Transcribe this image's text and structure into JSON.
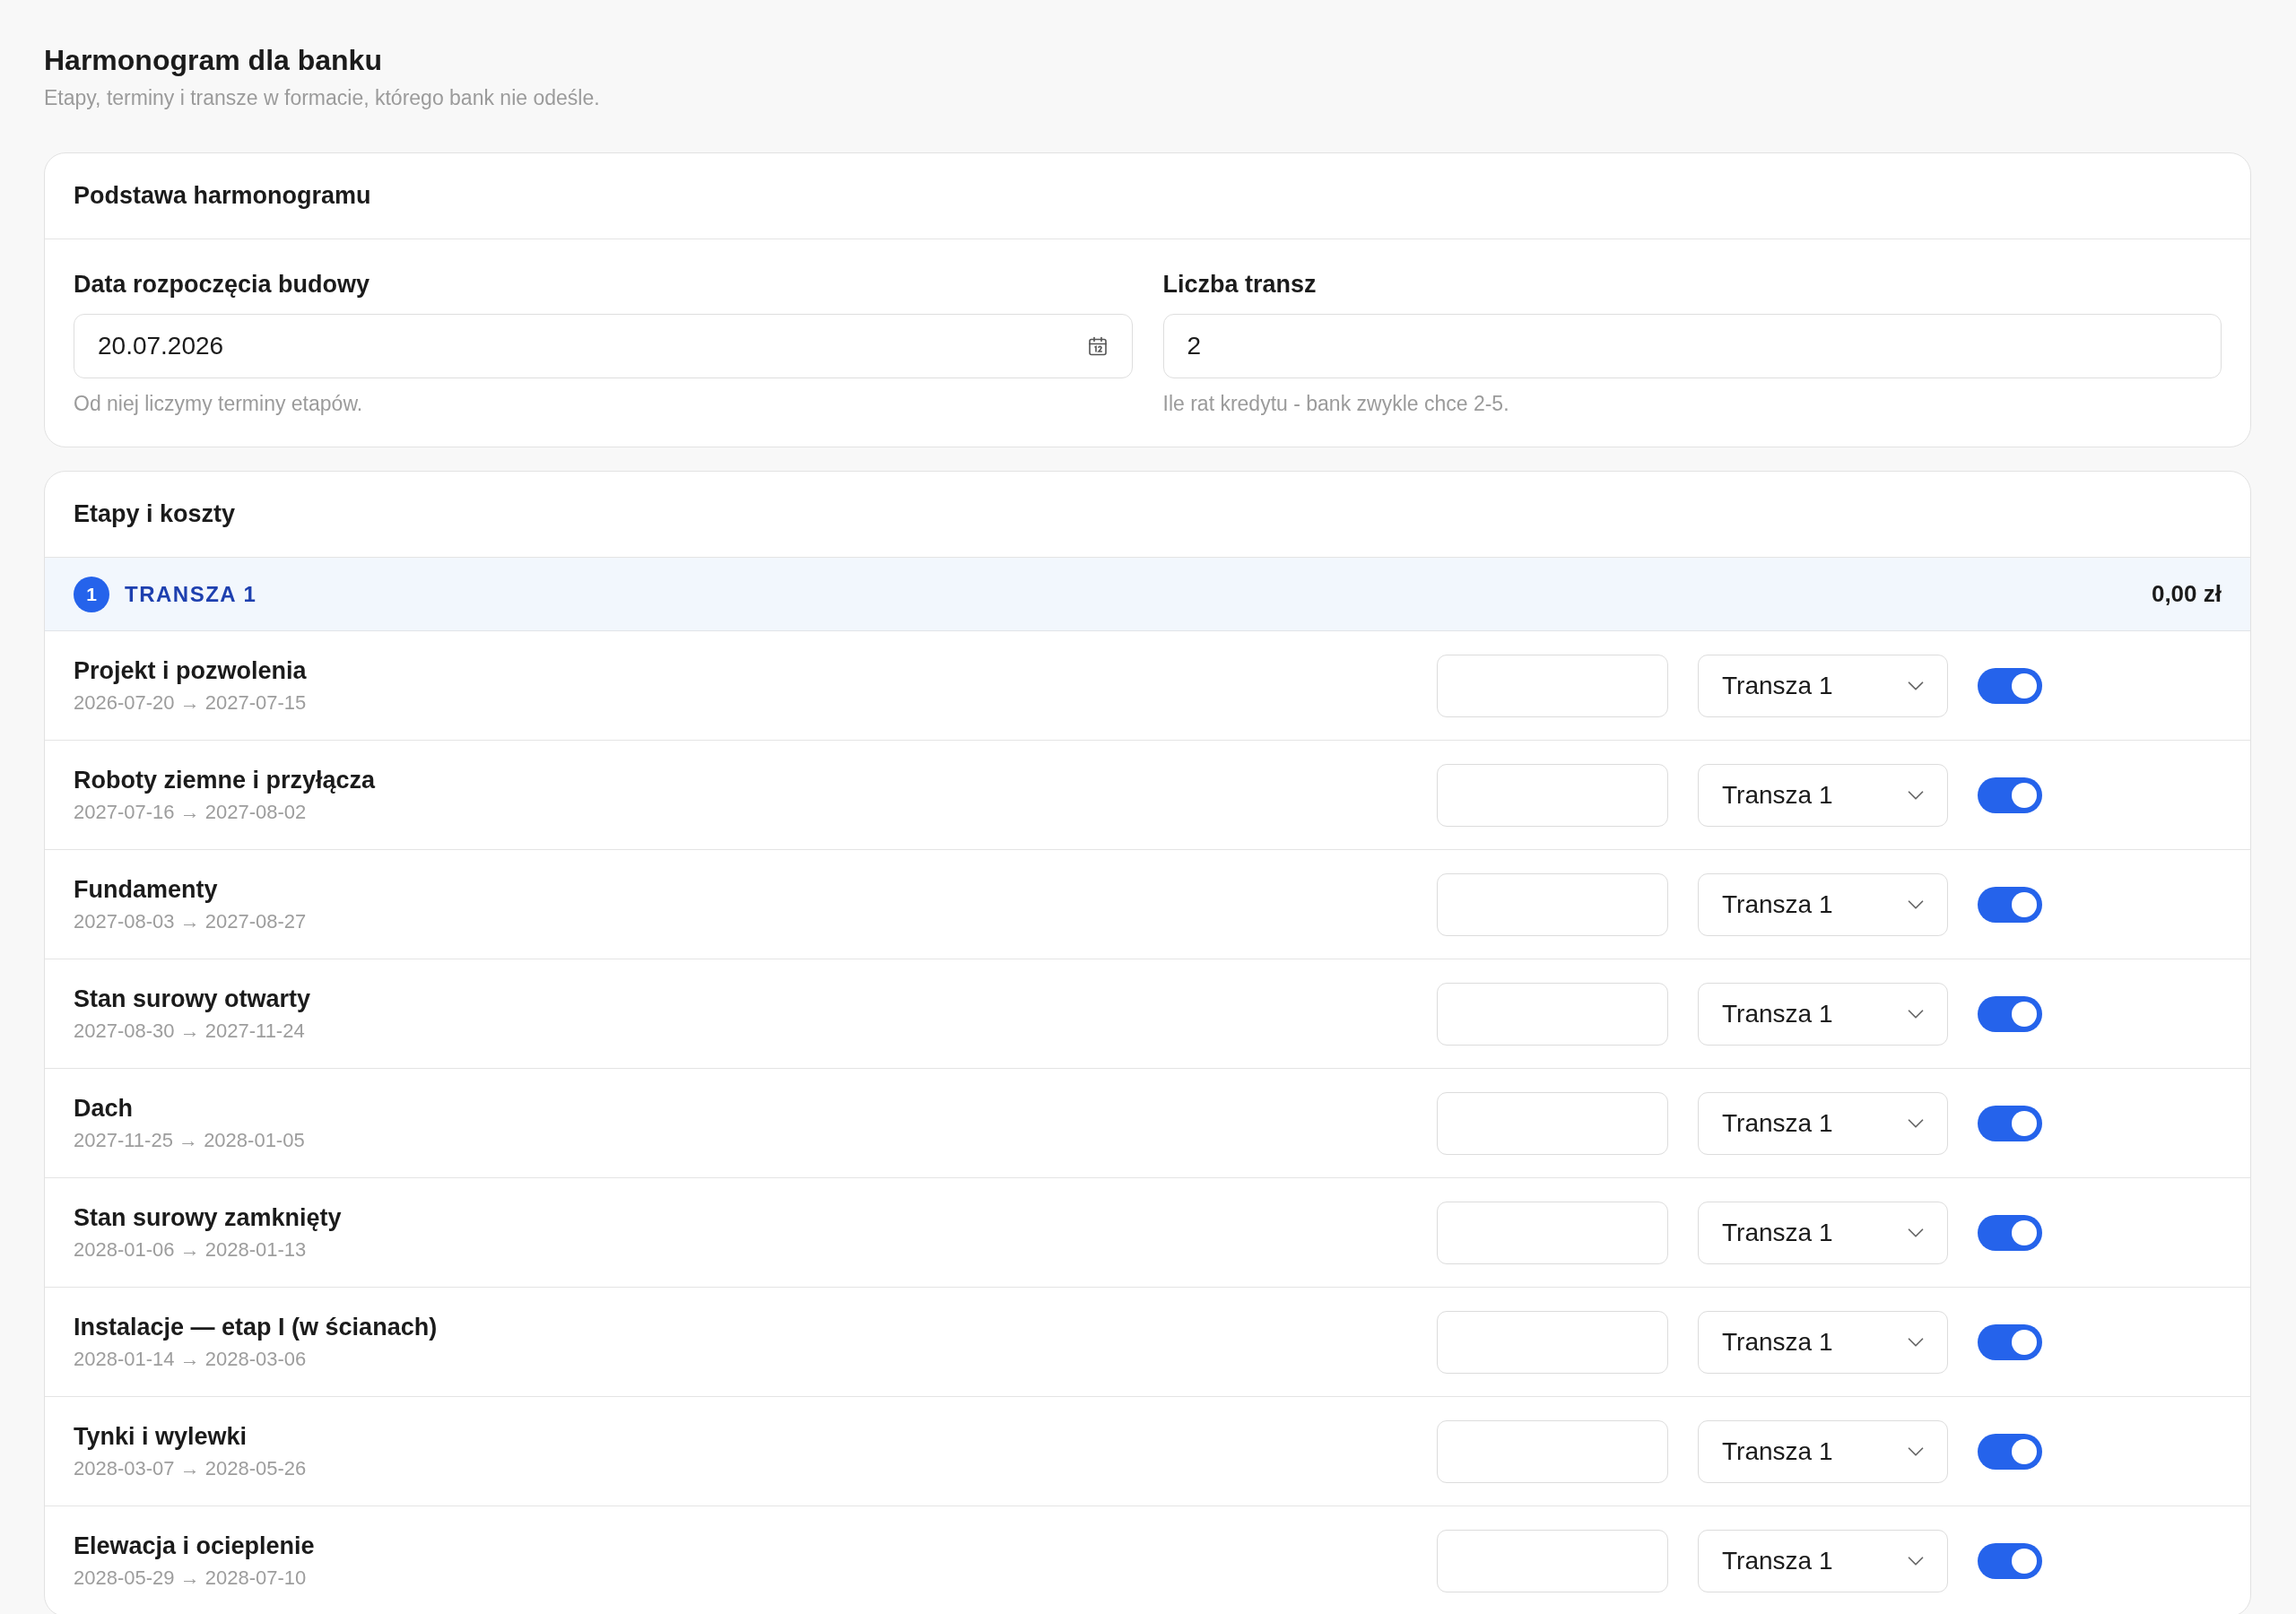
{
  "page": {
    "title": "Harmonogram dla banku",
    "subtitle": "Etapy, terminy i transze w formacie, którego bank nie odeśle."
  },
  "basis_card": {
    "title": "Podstawa harmonogramu",
    "fields": [
      {
        "kind": "date",
        "label": "Data rozpoczęcia budowy",
        "value": "20.07.2026",
        "hint": "Od niej liczymy terminy etapów."
      },
      {
        "kind": "number",
        "label": "Liczba transz",
        "value": "2",
        "hint": "Ile rat kredytu - bank zwykle chce 2-5."
      }
    ]
  },
  "stages_card": {
    "title": "Etapy i koszty",
    "tranches": [
      {
        "number": "1",
        "label": "TRANSZA 1",
        "total": "0,00 zł",
        "stages": [
          {
            "name": "Projekt i pozwolenia",
            "dates": "2026-07-20 → 2027-07-15",
            "tranche": "Transza 1",
            "on": true
          },
          {
            "name": "Roboty ziemne i przyłącza",
            "dates": "2027-07-16 → 2027-08-02",
            "tranche": "Transza 1",
            "on": true
          },
          {
            "name": "Fundamenty",
            "dates": "2027-08-03 → 2027-08-27",
            "tranche": "Transza 1",
            "on": true
          },
          {
            "name": "Stan surowy otwarty",
            "dates": "2027-08-30 → 2027-11-24",
            "tranche": "Transza 1",
            "on": true
          },
          {
            "name": "Dach",
            "dates": "2027-11-25 → 2028-01-05",
            "tranche": "Transza 1",
            "on": true
          },
          {
            "name": "Stan surowy zamknięty",
            "dates": "2028-01-06 → 2028-01-13",
            "tranche": "Transza 1",
            "on": true
          },
          {
            "name": "Instalacje — etap I (w ścianach)",
            "dates": "2028-01-14 → 2028-03-06",
            "tranche": "Transza 1",
            "on": true
          },
          {
            "name": "Tynki i wylewki",
            "dates": "2028-03-07 → 2028-05-26",
            "tranche": "Transza 1",
            "on": true
          },
          {
            "name": "Elewacja i ocieplenie",
            "dates": "2028-05-29 → 2028-07-10",
            "tranche": "Transza 1",
            "on": true
          }
        ]
      }
    ]
  }
}
